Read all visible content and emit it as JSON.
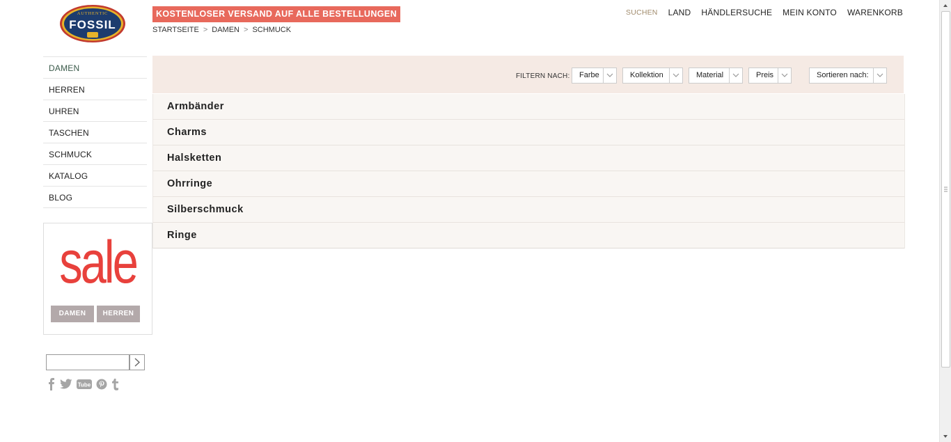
{
  "logo": {
    "brand": "FOSSIL",
    "tagline": "AUTHENTIC"
  },
  "promo": {
    "text": "KOSTENLOSER VERSAND AUF ALLE BESTELLUNGEN"
  },
  "breadcrumb": {
    "items": [
      "STARTSEITE",
      "DAMEN",
      "SCHMUCK"
    ],
    "separator": ">"
  },
  "topnav": {
    "search": "SUCHEN",
    "country": "LAND",
    "dealer": "HÄNDLERSUCHE",
    "account": "MEIN KONTO",
    "cart": "WARENKORB"
  },
  "sidebar": {
    "items": [
      {
        "label": "DAMEN"
      },
      {
        "label": "HERREN"
      },
      {
        "label": "UHREN"
      },
      {
        "label": "TASCHEN"
      },
      {
        "label": "SCHMUCK"
      },
      {
        "label": "KATALOG"
      },
      {
        "label": "BLOG"
      }
    ]
  },
  "sale": {
    "word": "sale",
    "women": "DAMEN",
    "men": "HERREN"
  },
  "filters": {
    "label": "FILTERN NACH:",
    "color": "Farbe",
    "collection": "Kollektion",
    "material": "Material",
    "price": "Preis",
    "sort": "Sortieren nach:"
  },
  "categories": [
    {
      "label": "Armbänder"
    },
    {
      "label": "Charms"
    },
    {
      "label": "Halsketten"
    },
    {
      "label": "Ohrringe"
    },
    {
      "label": "Silberschmuck"
    },
    {
      "label": "Ringe"
    }
  ],
  "colors": {
    "promo": "#e8695c",
    "sale_red": "#e8413c",
    "filter_bg": "#f5eae4",
    "logo_navy": "#1d3c6e",
    "logo_gold": "#e7b32a",
    "logo_red": "#c23a2e",
    "icon_gray": "#a5a5a5"
  },
  "icons": {
    "social": [
      "facebook-icon",
      "twitter-icon",
      "youtube-icon",
      "pinterest-icon",
      "tumblr-icon"
    ]
  }
}
